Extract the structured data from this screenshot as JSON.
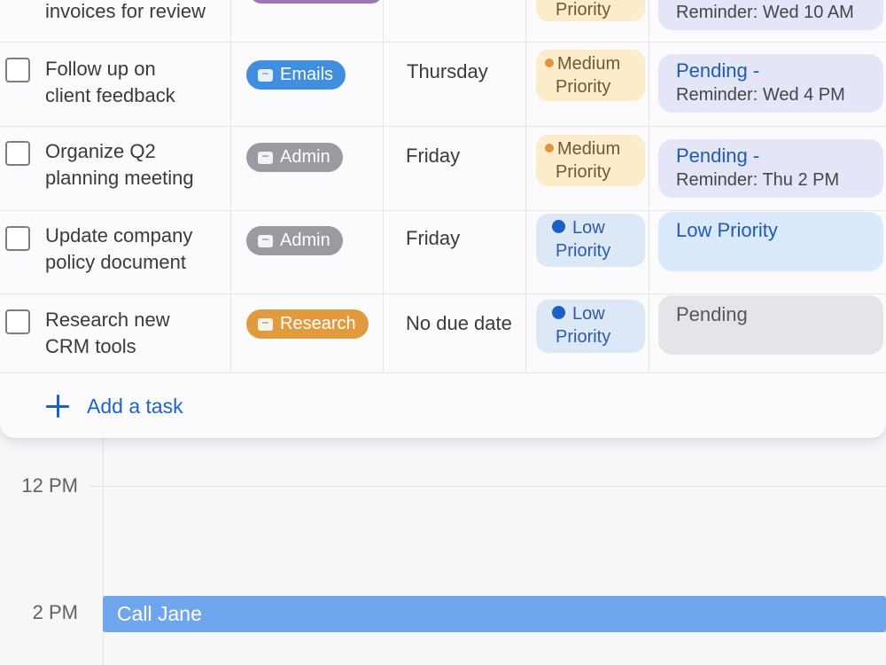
{
  "calendar": {
    "hours": [
      "12 PM",
      "2 PM"
    ],
    "event": {
      "title": "Call Jane",
      "color": "#6ea5ec"
    }
  },
  "tasks": [
    {
      "title_lines": [
        "",
        "invoices for review"
      ],
      "category": {
        "label": "",
        "color": "#9b77b8"
      },
      "due": "",
      "priority": {
        "line1": "",
        "line2": "Priority",
        "level": "medium"
      },
      "status": {
        "main": "",
        "sub": "Reminder: Wed 10 AM"
      }
    },
    {
      "title_lines": [
        "Follow up on",
        "client feedback"
      ],
      "category": {
        "label": "Emails",
        "icon": "email-icon",
        "color": "#3f8fde"
      },
      "due": "Thursday",
      "priority": {
        "line1": "Medium",
        "line2": "Priority",
        "level": "medium"
      },
      "status": {
        "main": "Pending -",
        "sub": "Reminder: Wed 4 PM"
      }
    },
    {
      "title_lines": [
        "Organize Q2",
        "planning meeting"
      ],
      "category": {
        "label": "Admin",
        "icon": "admin-icon",
        "color": "#9a9aa1"
      },
      "due": "Friday",
      "priority": {
        "line1": "Medium",
        "line2": "Priority",
        "level": "medium"
      },
      "status": {
        "main": "Pending -",
        "sub": "Reminder: Thu 2 PM"
      }
    },
    {
      "title_lines": [
        "Update company",
        "policy document"
      ],
      "category": {
        "label": "Admin",
        "icon": "admin-icon",
        "color": "#9a9aa1"
      },
      "due": "Friday",
      "priority": {
        "line1": "Low",
        "line2": "Priority",
        "level": "low"
      },
      "status": {
        "main": "Low Priority",
        "sub": ""
      }
    },
    {
      "title_lines": [
        "Research new",
        "CRM tools"
      ],
      "category": {
        "label": "Research",
        "icon": "folder-icon",
        "color": "#e29a3e"
      },
      "due": "No due date",
      "priority": {
        "line1": "Low",
        "line2": "Priority",
        "level": "low"
      },
      "status": {
        "main": "Pending",
        "sub": ""
      }
    }
  ],
  "add_task_label": "Add a task",
  "colors": {
    "accent": "#1a63c9",
    "medium_priority_dot": "#e2953c",
    "low_priority_dot": "#1b5fc7"
  }
}
